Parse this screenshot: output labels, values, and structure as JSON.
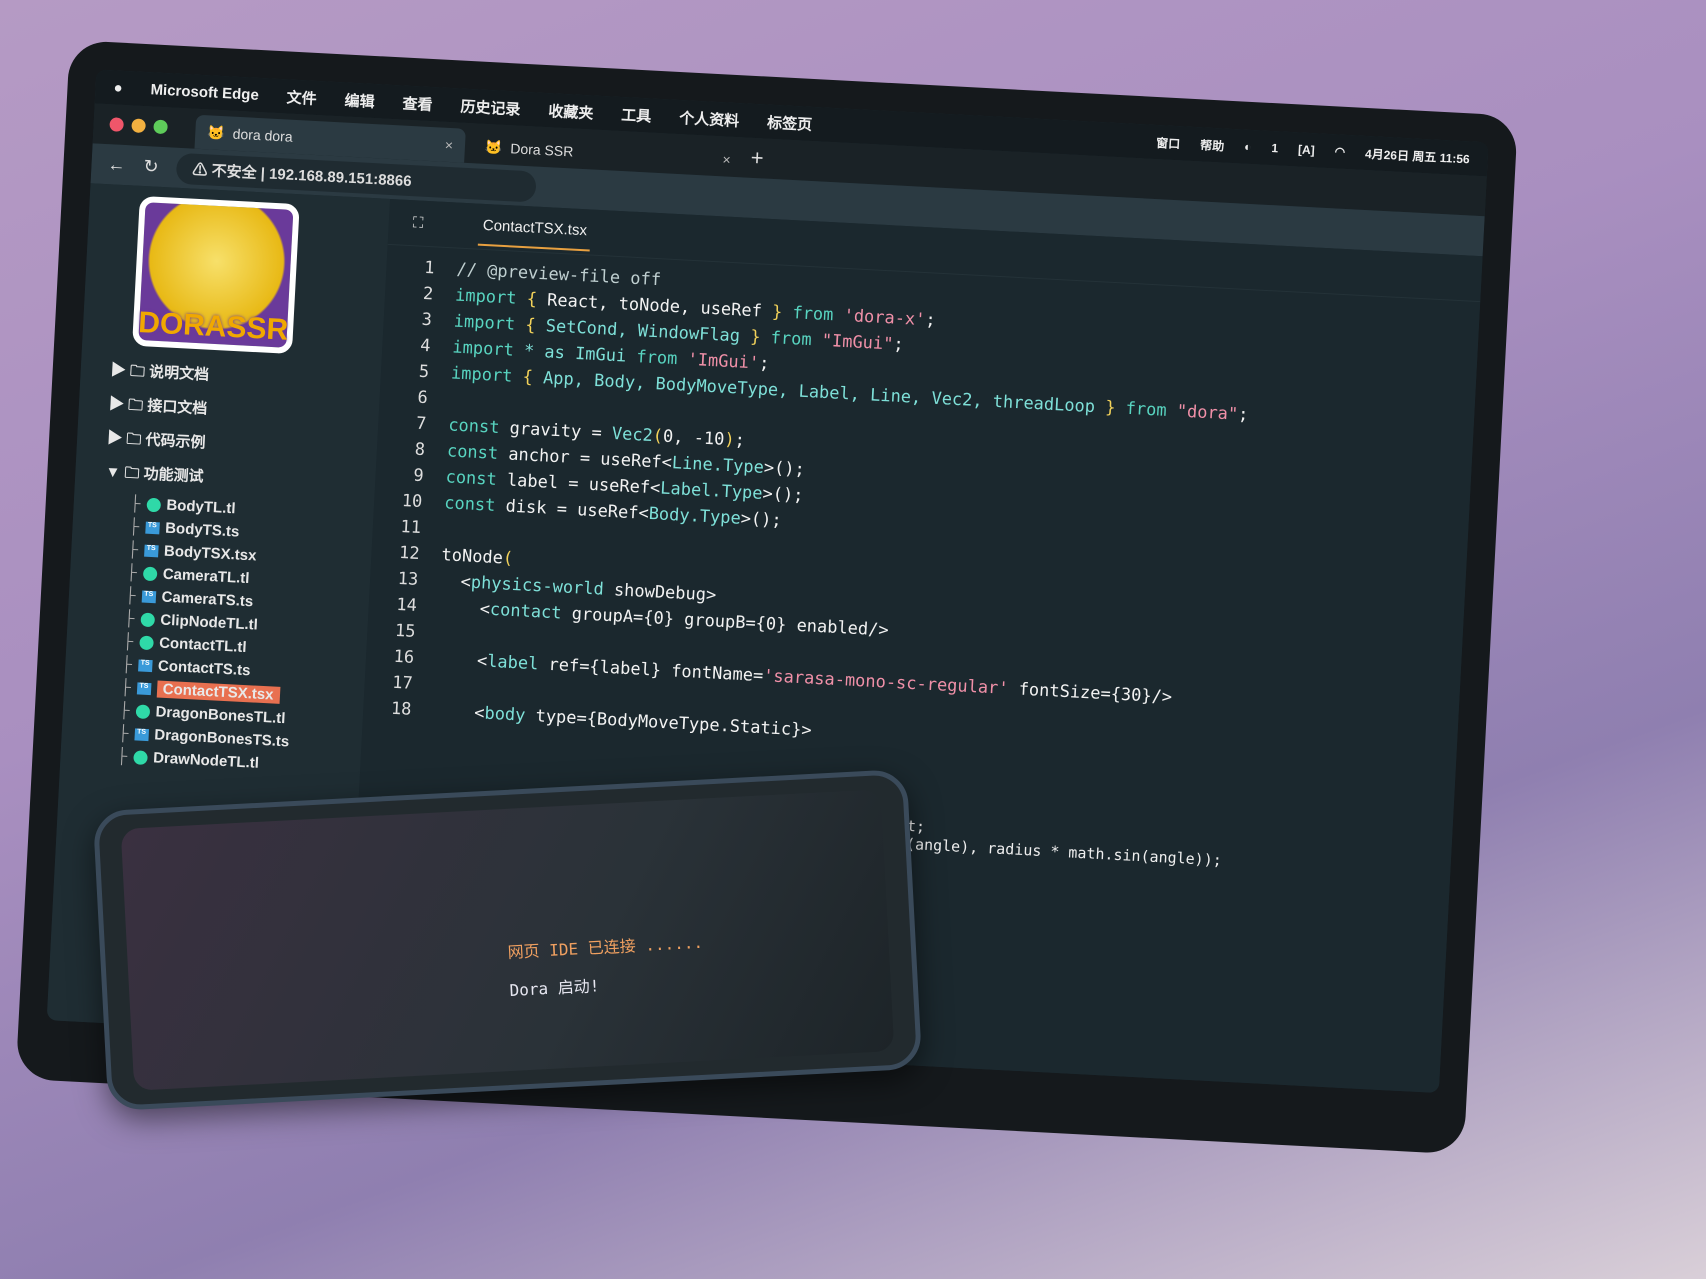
{
  "menubar": {
    "apple": "",
    "app": "Microsoft Edge",
    "items": [
      "文件",
      "编辑",
      "查看",
      "历史记录",
      "收藏夹",
      "工具",
      "个人资料",
      "标签页",
      "窗口",
      "帮助"
    ],
    "status_badge": "1",
    "datetime": "4月26日 周五 11:56"
  },
  "browser": {
    "tabs": [
      {
        "title": "dora dora",
        "close": "×"
      },
      {
        "title": "Dora SSR",
        "close": "×"
      }
    ],
    "new_tab": "+",
    "security": "不安全",
    "url": "192.168.89.151:8866"
  },
  "colors": {
    "accent": "#e87050",
    "tab_underline": "#e8a040",
    "keyword": "#58d4c0",
    "string": "#f090a8",
    "bracket": "#f2d25a"
  },
  "sidebar": {
    "logo_text": "DORASSR",
    "folders": [
      {
        "name": "说明文档",
        "open": false
      },
      {
        "name": "接口文档",
        "open": false
      },
      {
        "name": "代码示例",
        "open": false
      },
      {
        "name": "功能测试",
        "open": true
      }
    ],
    "files": [
      {
        "name": "BodyTL.tl",
        "type": "tl"
      },
      {
        "name": "BodyTS.ts",
        "type": "ts"
      },
      {
        "name": "BodyTSX.tsx",
        "type": "ts"
      },
      {
        "name": "CameraTL.tl",
        "type": "tl"
      },
      {
        "name": "CameraTS.ts",
        "type": "ts"
      },
      {
        "name": "ClipNodeTL.tl",
        "type": "tl"
      },
      {
        "name": "ContactTL.tl",
        "type": "tl"
      },
      {
        "name": "ContactTS.ts",
        "type": "ts"
      },
      {
        "name": "ContactTSX.tsx",
        "type": "ts",
        "selected": true
      },
      {
        "name": "DragonBonesTL.tl",
        "type": "tl"
      },
      {
        "name": "DragonBonesTS.ts",
        "type": "ts"
      },
      {
        "name": "DrawNodeTL.tl",
        "type": "tl"
      }
    ]
  },
  "editor": {
    "tab": "ContactTSX.tsx",
    "lines": [
      [
        [
          "// @preview-file off",
          "cm"
        ]
      ],
      [
        [
          "import ",
          "kw"
        ],
        [
          "{ ",
          "br"
        ],
        [
          "React, toNode, useRef ",
          "id"
        ],
        [
          "} ",
          "br"
        ],
        [
          "from ",
          "kw"
        ],
        [
          "'dora-x'",
          "str"
        ],
        [
          ";",
          "id"
        ]
      ],
      [
        [
          "import ",
          "kw"
        ],
        [
          "{ ",
          "br"
        ],
        [
          "SetCond, WindowFlag ",
          "tg"
        ],
        [
          "} ",
          "br"
        ],
        [
          "from ",
          "kw"
        ],
        [
          "\"ImGui\"",
          "str"
        ],
        [
          ";",
          "id"
        ]
      ],
      [
        [
          "import ",
          "kw"
        ],
        [
          "* as ImGui ",
          "tg"
        ],
        [
          "from ",
          "kw"
        ],
        [
          "'ImGui'",
          "str"
        ],
        [
          ";",
          "id"
        ]
      ],
      [
        [
          "import ",
          "kw"
        ],
        [
          "{ ",
          "br"
        ],
        [
          "App, Body, BodyMoveType, Label, Line, Vec2, threadLoop ",
          "tg"
        ],
        [
          "} ",
          "br"
        ],
        [
          "from ",
          "kw"
        ],
        [
          "\"dora\"",
          "str"
        ],
        [
          ";",
          "id"
        ]
      ],
      [],
      [
        [
          "const ",
          "kw"
        ],
        [
          "gravity = ",
          "id"
        ],
        [
          "Vec2",
          "tg"
        ],
        [
          "(",
          "br"
        ],
        [
          "0, -10",
          "id"
        ],
        [
          ")",
          "br"
        ],
        [
          ";",
          "id"
        ]
      ],
      [
        [
          "const ",
          "kw"
        ],
        [
          "anchor = useRef<",
          "id"
        ],
        [
          "Line.Type",
          "tg"
        ],
        [
          ">();",
          "id"
        ]
      ],
      [
        [
          "const ",
          "kw"
        ],
        [
          "label = useRef<",
          "id"
        ],
        [
          "Label.Type",
          "tg"
        ],
        [
          ">();",
          "id"
        ]
      ],
      [
        [
          "const ",
          "kw"
        ],
        [
          "disk = useRef<",
          "id"
        ],
        [
          "Body.Type",
          "tg"
        ],
        [
          ">();",
          "id"
        ]
      ],
      [],
      [
        [
          "toNode",
          "id"
        ],
        [
          "(",
          "br"
        ]
      ],
      [
        [
          "  <",
          "id"
        ],
        [
          "physics-world ",
          "tg"
        ],
        [
          "showDebug>",
          "id"
        ]
      ],
      [
        [
          "    <",
          "id"
        ],
        [
          "contact ",
          "tg"
        ],
        [
          "groupA={0} groupB={0} enabled/>",
          "id"
        ]
      ],
      [],
      [
        [
          "    <",
          "id"
        ],
        [
          "label ",
          "tg"
        ],
        [
          "ref={label} fontName=",
          "id"
        ],
        [
          "'sarasa-mono-sc-regular'",
          "str"
        ],
        [
          " fontSize={30}/>",
          "id"
        ]
      ],
      [],
      [
        [
          "    <",
          "id"
        ],
        [
          "body ",
          "tg"
        ],
        [
          "type={BodyMoveType.Static}>",
          "id"
        ]
      ]
    ],
    "partial_line_a": "nt;",
    "partial_line_b": "s(angle), radius * math.sin(angle));"
  },
  "phone": {
    "log": [
      "网页 IDE 已连接 ......",
      "Dora 启动!"
    ]
  }
}
